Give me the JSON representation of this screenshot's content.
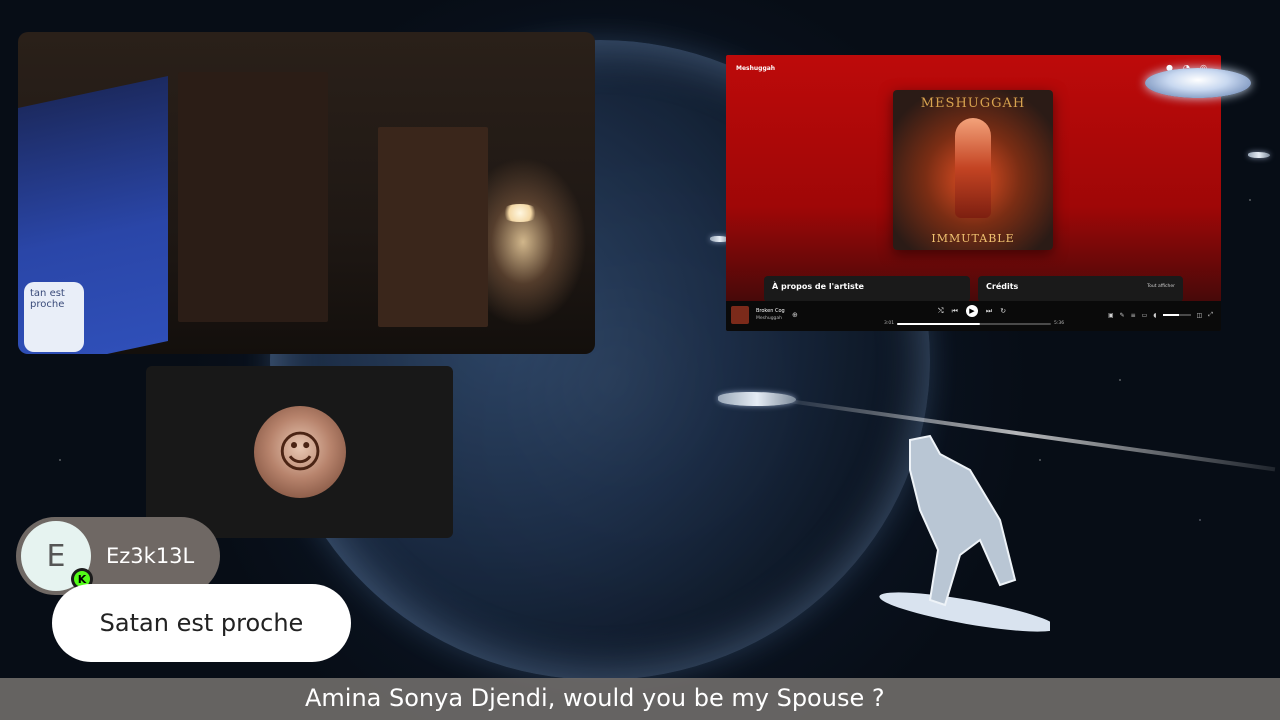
{
  "music_player": {
    "artist_header": "Meshuggah",
    "album_art": {
      "band_name": "MESHUGGAH",
      "album_name": "IMMUTABLE"
    },
    "about_artist_label": "À propos de l'artiste",
    "credits_label": "Crédits",
    "show_all_label": "Tout afficher",
    "now_playing": {
      "title": "Broken Cog",
      "artist": "Meshuggah",
      "elapsed": "3:01",
      "duration": "5:36",
      "progress_fraction": 0.54,
      "volume_fraction": 0.6
    },
    "colors": {
      "background": "#bd0a0a",
      "player_bar": "#0a0a0a"
    }
  },
  "chat": {
    "username": "Ez3k13L",
    "avatar_initial": "E",
    "platform_badge": "K",
    "message": "Satan est proche",
    "colors": {
      "badge": "#53fc18"
    }
  },
  "webcam": {
    "desk_text": "tan est proche"
  },
  "ticker": {
    "text": "Amina Sonya Djendi, would you be my Spouse ?"
  }
}
